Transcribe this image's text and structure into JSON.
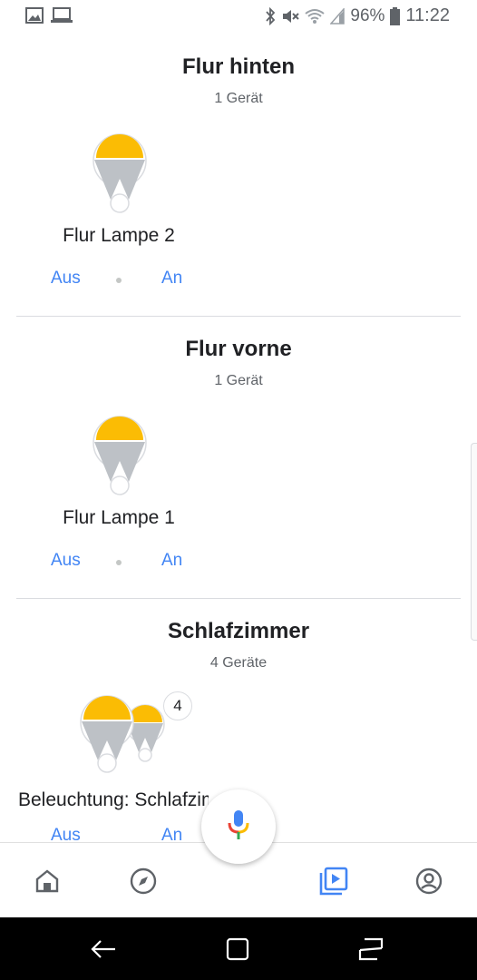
{
  "status_bar": {
    "battery_percent": "96%",
    "time": "11:22",
    "left_icons": [
      "image-icon",
      "laptop-icon"
    ],
    "right_icons": [
      "bluetooth-icon",
      "mute-icon",
      "wifi-icon",
      "signal-icon",
      "battery-icon"
    ]
  },
  "rooms": [
    {
      "title": "Flur hinten",
      "count": "1 Gerät",
      "device_name": "Flur Lampe 2",
      "off_label": "Aus",
      "on_label": "An"
    },
    {
      "title": "Flur vorne",
      "count": "1 Gerät",
      "device_name": "Flur Lampe 1",
      "off_label": "Aus",
      "on_label": "An"
    },
    {
      "title": "Schlafzimmer",
      "count": "4 Geräte",
      "device_name": "Beleuchtung: Schlafzimmer",
      "group_count": "4",
      "off_label": "Aus",
      "on_label": "An"
    }
  ],
  "colors": {
    "accent_blue": "#4285f4",
    "bulb_yellow": "#fbbc04",
    "bulb_gray": "#bdc1c6"
  },
  "bottom_nav": {
    "items": [
      "home-icon",
      "explore-icon",
      "media-icon",
      "account-icon"
    ],
    "active": "media-icon"
  },
  "fab": {
    "icon": "microphone-icon"
  }
}
